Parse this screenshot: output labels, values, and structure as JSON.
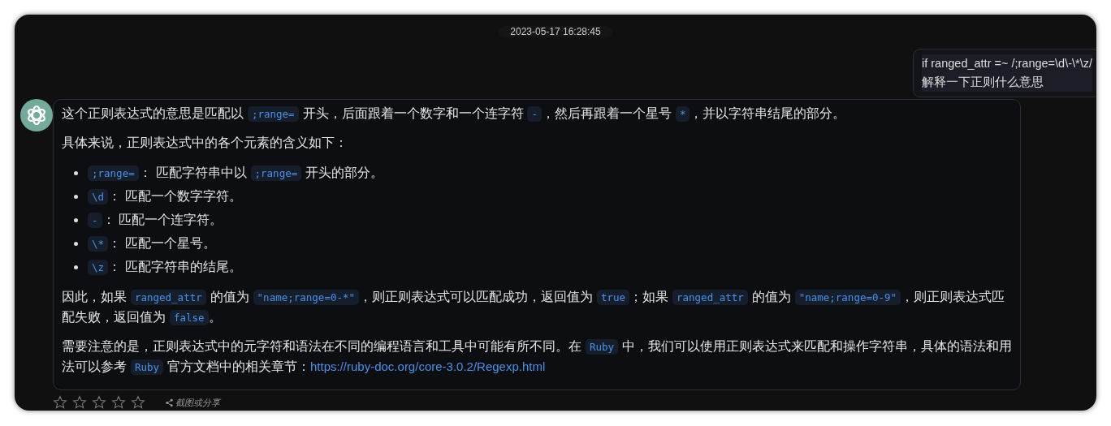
{
  "timestamp": "2023-05-17 16:28:45",
  "user_message": {
    "lines": [
      "if ranged_attr =~ /;range=\\d\\-\\*\\z/",
      "解释一下正则什么意思"
    ]
  },
  "assistant_message": {
    "blocks": [
      {
        "kind": "paragraph",
        "parts": [
          {
            "kind": "text",
            "text": "这个正则表达式的意思是匹配以 "
          },
          {
            "kind": "code",
            "text": ";range="
          },
          {
            "kind": "text",
            "text": " 开头，后面跟着一个数字和一个连字符 "
          },
          {
            "kind": "code",
            "text": "-"
          },
          {
            "kind": "text",
            "text": "，然后再跟着一个星号 "
          },
          {
            "kind": "code",
            "text": "*"
          },
          {
            "kind": "text",
            "text": "，并以字符串结尾的部分。"
          }
        ]
      },
      {
        "kind": "paragraph",
        "parts": [
          {
            "kind": "text",
            "text": "具体来说，正则表达式中的各个元素的含义如下："
          }
        ]
      },
      {
        "kind": "list",
        "items": [
          {
            "parts": [
              {
                "kind": "code",
                "text": ";range="
              },
              {
                "kind": "text",
                "text": "： 匹配字符串中以 "
              },
              {
                "kind": "code",
                "text": ";range="
              },
              {
                "kind": "text",
                "text": " 开头的部分。"
              }
            ]
          },
          {
            "parts": [
              {
                "kind": "code",
                "text": "\\d"
              },
              {
                "kind": "text",
                "text": "： 匹配一个数字字符。"
              }
            ]
          },
          {
            "parts": [
              {
                "kind": "code",
                "text": "-"
              },
              {
                "kind": "text",
                "text": "： 匹配一个连字符。"
              }
            ]
          },
          {
            "parts": [
              {
                "kind": "code",
                "text": "\\*"
              },
              {
                "kind": "text",
                "text": "： 匹配一个星号。"
              }
            ]
          },
          {
            "parts": [
              {
                "kind": "code",
                "text": "\\z"
              },
              {
                "kind": "text",
                "text": "： 匹配字符串的结尾。"
              }
            ]
          }
        ]
      },
      {
        "kind": "paragraph",
        "parts": [
          {
            "kind": "text",
            "text": "因此，如果 "
          },
          {
            "kind": "code",
            "text": "ranged_attr"
          },
          {
            "kind": "text",
            "text": " 的值为 "
          },
          {
            "kind": "code",
            "text": "\"name;range=0-*\""
          },
          {
            "kind": "text",
            "text": "，则正则表达式可以匹配成功，返回值为 "
          },
          {
            "kind": "code",
            "text": "true"
          },
          {
            "kind": "text",
            "text": "；如果 "
          },
          {
            "kind": "code",
            "text": "ranged_attr"
          },
          {
            "kind": "text",
            "text": " 的值为 "
          },
          {
            "kind": "code",
            "text": "\"name;range=0-9\""
          },
          {
            "kind": "text",
            "text": "，则正则表达式匹配失败，返回值为 "
          },
          {
            "kind": "code",
            "text": "false"
          },
          {
            "kind": "text",
            "text": "。"
          }
        ]
      },
      {
        "kind": "paragraph",
        "parts": [
          {
            "kind": "text",
            "text": "需要注意的是，正则表达式中的元字符和语法在不同的编程语言和工具中可能有所不同。在 "
          },
          {
            "kind": "code",
            "text": "Ruby"
          },
          {
            "kind": "text",
            "text": " 中，我们可以使用正则表达式来匹配和操作字符串，具体的语法和用法可以参考 "
          },
          {
            "kind": "code",
            "text": "Ruby"
          },
          {
            "kind": "text",
            "text": " 官方文档中的相关章节："
          },
          {
            "kind": "link",
            "text": "https://ruby-doc.org/core-3.0.2/Regexp.html"
          }
        ]
      }
    ]
  },
  "rating": {
    "stars": 0
  },
  "share_label": "截图或分享"
}
